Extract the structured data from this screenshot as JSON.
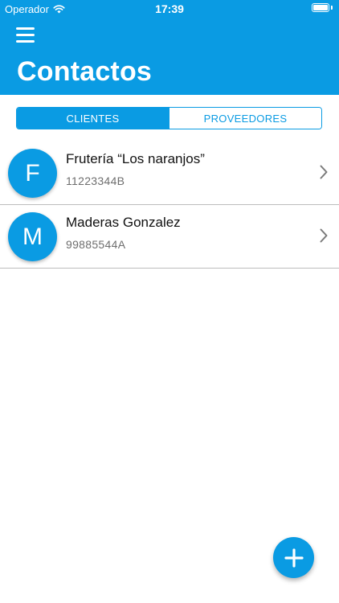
{
  "status_bar": {
    "carrier": "Operador",
    "time": "17:39",
    "battery_level": 1.0
  },
  "header": {
    "title": "Contactos",
    "menu_icon": "hamburger-menu-icon"
  },
  "tabs": [
    {
      "label": "CLIENTES",
      "active": true
    },
    {
      "label": "PROVEEDORES",
      "active": false
    }
  ],
  "contacts": [
    {
      "initial": "F",
      "name": "Frutería “Los naranjos”",
      "id": "11223344B"
    },
    {
      "initial": "M",
      "name": "Maderas Gonzalez",
      "id": "99885544A"
    }
  ],
  "fab": {
    "icon": "plus-icon"
  },
  "colors": {
    "primary": "#0a9be3",
    "divider": "#bdbdbd",
    "secondary_text": "#6e6e6e"
  }
}
